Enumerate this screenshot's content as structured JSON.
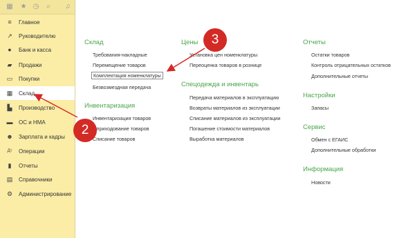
{
  "sidebar": {
    "items": [
      {
        "label": "Главное",
        "icon": "menu-lines-icon"
      },
      {
        "label": "Руководителю",
        "icon": "trend-up-icon"
      },
      {
        "label": "Банк и касса",
        "icon": "coin-icon"
      },
      {
        "label": "Продажи",
        "icon": "cart-icon"
      },
      {
        "label": "Покупки",
        "icon": "basket-icon"
      },
      {
        "label": "Склад",
        "icon": "grid-icon"
      },
      {
        "label": "Производство",
        "icon": "factory-icon"
      },
      {
        "label": "ОС и НМА",
        "icon": "car-icon"
      },
      {
        "label": "Зарплата и кадры",
        "icon": "people-icon"
      },
      {
        "label": "Операции",
        "icon": "dt-kt-icon"
      },
      {
        "label": "Отчеты",
        "icon": "bar-chart-icon"
      },
      {
        "label": "Справочники",
        "icon": "book-icon"
      },
      {
        "label": "Администрирование",
        "icon": "gear-icon"
      }
    ]
  },
  "sections": {
    "sklad": {
      "title": "Склад",
      "links": [
        "Требования-накладные",
        "Перемещение товаров",
        "Комплектация номенклатуры",
        "Безвозмездная передача"
      ]
    },
    "inventory": {
      "title": "Инвентаризация",
      "links": [
        "Инвентаризация товаров",
        "Оприходование товаров",
        "Списание товаров"
      ]
    },
    "prices": {
      "title": "Цены",
      "links": [
        "Установка цен номенклатуры",
        "Переоценка товаров в рознице"
      ]
    },
    "special": {
      "title": "Спецодежда и инвентарь",
      "links": [
        "Передача материалов в эксплуатацию",
        "Возвраты материалов из эксплуатации",
        "Списание материалов из эксплуатации",
        "Погашение стоимости материалов",
        "Выработка материалов"
      ]
    },
    "reports": {
      "title": "Отчеты",
      "links": [
        "Остатки товаров",
        "Контроль отрицательных остатков",
        "Дополнительные отчеты"
      ]
    },
    "settings": {
      "title": "Настройки",
      "links": [
        "Запасы"
      ]
    },
    "service": {
      "title": "Сервис",
      "links": [
        "Обмен с ЕГАИС",
        "Дополнительные обработки"
      ]
    },
    "info": {
      "title": "Информация",
      "links": [
        "Новости"
      ]
    }
  },
  "markers": {
    "one": "3",
    "two": "2"
  },
  "colors": {
    "sidebar_bg": "#fbeda6",
    "section_title": "#4aa54a",
    "marker": "#d42a26"
  }
}
